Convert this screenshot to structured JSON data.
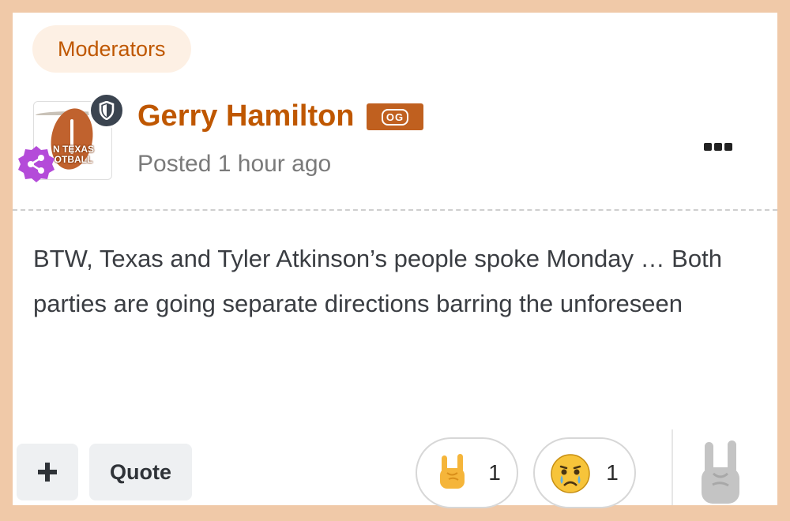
{
  "group": {
    "label": "Moderators"
  },
  "author": {
    "name": "Gerry Hamilton",
    "badge_text": "OG",
    "avatar_text_line1": "N TEXAS",
    "avatar_text_line2": "OTBALL",
    "avatar_icon": "longhorn-football-logo",
    "moderator_icon": "shield-icon",
    "share_icon": "share-icon"
  },
  "post": {
    "time": "Posted 1 hour ago",
    "body": "BTW, Texas and Tyler Atkinson’s people spoke Monday … Both parties are going separate directions barring the unforeseen"
  },
  "actions": {
    "add_icon": "plus-icon",
    "quote_label": "Quote",
    "more_icon": "ellipsis-icon",
    "react_icon": "hook-em-hand-icon"
  },
  "reactions": [
    {
      "icon": "hook-em-hand-icon",
      "count": "1"
    },
    {
      "icon": "crying-face-icon",
      "count": "1"
    }
  ],
  "colors": {
    "accent": "#bf5700",
    "page_border": "#f0c9a8",
    "moderator_badge": "#3b4450",
    "share_badge": "#b44bd9"
  }
}
